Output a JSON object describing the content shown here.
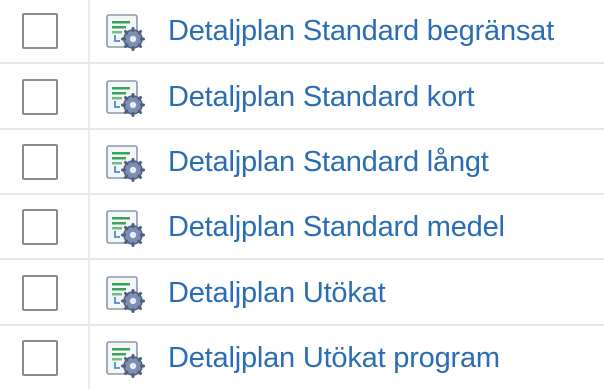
{
  "items": [
    {
      "label": "Detaljplan Standard begränsat",
      "icon": "workflow-gear-icon",
      "checked": false
    },
    {
      "label": "Detaljplan Standard kort",
      "icon": "workflow-gear-icon",
      "checked": false
    },
    {
      "label": "Detaljplan Standard långt",
      "icon": "workflow-gear-icon",
      "checked": false
    },
    {
      "label": "Detaljplan Standard medel",
      "icon": "workflow-gear-icon",
      "checked": false
    },
    {
      "label": "Detaljplan Utökat",
      "icon": "workflow-gear-icon",
      "checked": false
    },
    {
      "label": "Detaljplan Utökat program",
      "icon": "workflow-gear-icon",
      "checked": false
    }
  ],
  "colors": {
    "link": "#2a6db3",
    "checkbox_border": "#8c8c8c",
    "row_divider": "#e8e8e8"
  }
}
